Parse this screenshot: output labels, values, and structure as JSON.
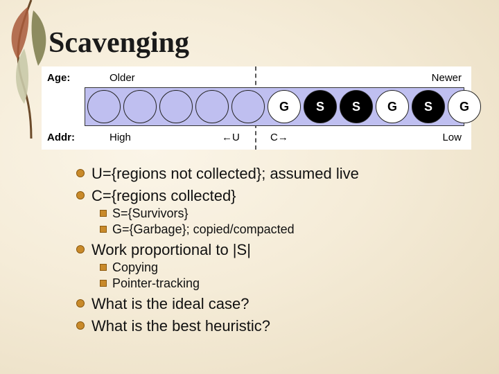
{
  "title": "Scavenging",
  "diagram": {
    "age_label": "Age:",
    "age_left": "Older",
    "age_right": "Newer",
    "addr_label": "Addr:",
    "addr_left": "High",
    "addr_u": "←U",
    "addr_c": "C→",
    "addr_right": "Low",
    "circles": [
      "",
      "",
      "",
      "",
      "",
      "G",
      "S",
      "S",
      "G",
      "S",
      "G"
    ]
  },
  "bullets": {
    "u_def": "U={regions not collected}; assumed live",
    "c_def": "C={regions collected}",
    "s_def": "S={Survivors}",
    "g_def": "G={Garbage}; copied/compacted",
    "work": "Work proportional to |S|",
    "copying": "Copying",
    "pointer": "Pointer-tracking",
    "ideal": "What is the ideal case?",
    "heuristic": "What is the best heuristic?"
  },
  "chart_data": {
    "type": "table",
    "title": "Memory region diagram (Scavenging GC)",
    "axes": {
      "age": {
        "left": "Older",
        "right": "Newer"
      },
      "addr": {
        "left": "High",
        "right": "Low",
        "boundary_labels": [
          "←U",
          "C→"
        ]
      }
    },
    "regions": [
      {
        "index": 0,
        "kind": "U",
        "label": ""
      },
      {
        "index": 1,
        "kind": "U",
        "label": ""
      },
      {
        "index": 2,
        "kind": "U",
        "label": ""
      },
      {
        "index": 3,
        "kind": "U",
        "label": ""
      },
      {
        "index": 4,
        "kind": "U",
        "label": ""
      },
      {
        "index": 5,
        "kind": "G",
        "label": "G"
      },
      {
        "index": 6,
        "kind": "S",
        "label": "S"
      },
      {
        "index": 7,
        "kind": "S",
        "label": "S"
      },
      {
        "index": 8,
        "kind": "G",
        "label": "G"
      },
      {
        "index": 9,
        "kind": "S",
        "label": "S"
      },
      {
        "index": 10,
        "kind": "G",
        "label": "G"
      }
    ],
    "boundary_after_index": 4,
    "legend": {
      "U": "regions not collected (assumed live)",
      "C": "regions collected",
      "S": "Survivors",
      "G": "Garbage (copied/compacted)"
    }
  }
}
